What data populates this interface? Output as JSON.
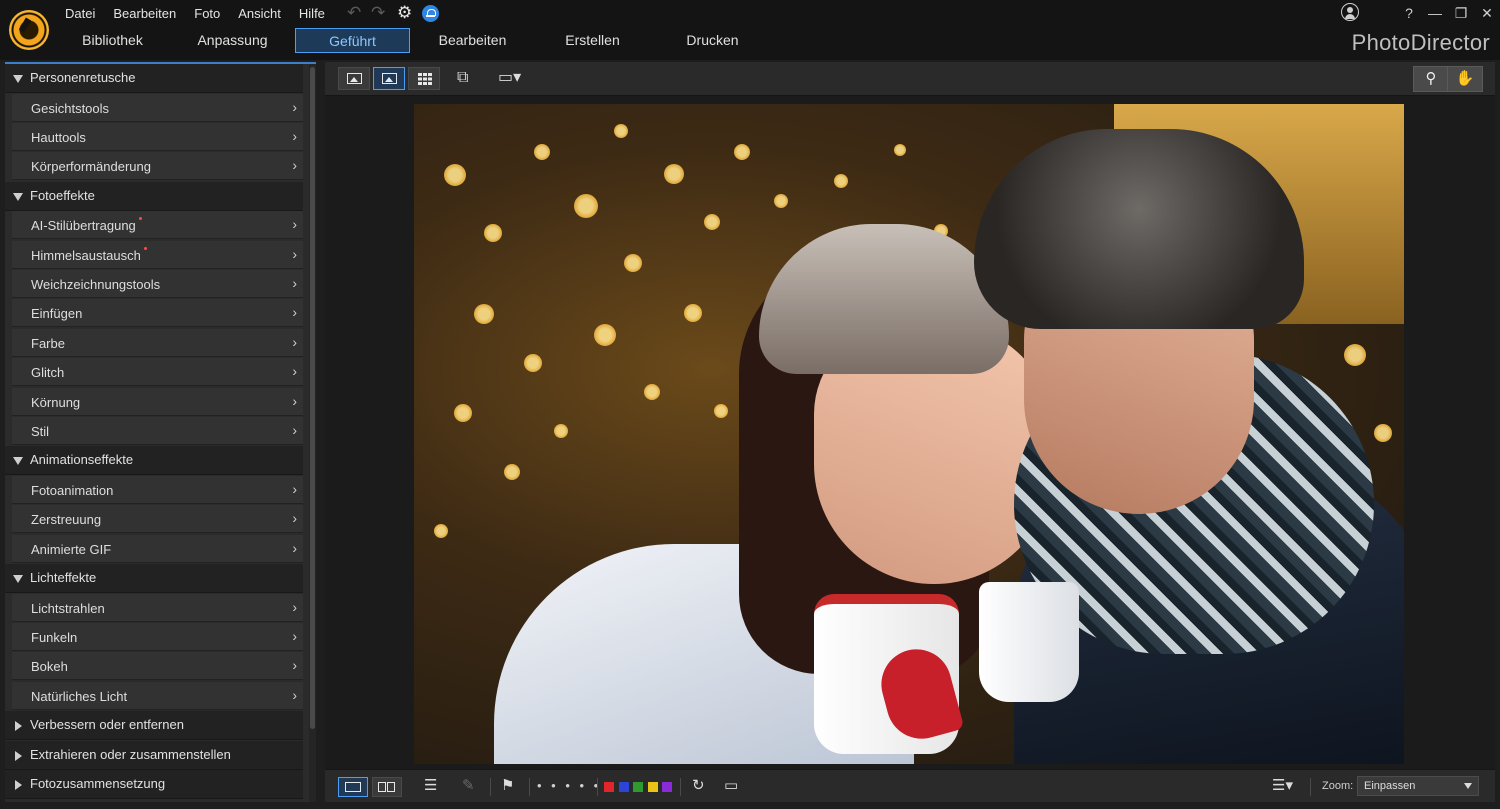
{
  "menu": [
    "Datei",
    "Bearbeiten",
    "Foto",
    "Ansicht",
    "Hilfe"
  ],
  "icons": {
    "undo": "↶",
    "redo": "↷",
    "settings": "⚙",
    "help": "?",
    "minimize": "—",
    "restore": "❐",
    "close": "✕",
    "chevron": "›",
    "search": "🔍",
    "hand": "✋",
    "sort": "☰",
    "rotate": "↻",
    "pen": "✎",
    "flag": "⚑",
    "compare": "⧉"
  },
  "nav_tabs": [
    "Bibliothek",
    "Anpassung",
    "Geführt",
    "Bearbeiten",
    "Erstellen",
    "Drucken"
  ],
  "active_tab": "Geführt",
  "brand": "PhotoDirector",
  "sections": [
    {
      "label": "Personenretusche",
      "open": true,
      "items": [
        {
          "label": "Gesichtstools"
        },
        {
          "label": "Hauttools"
        },
        {
          "label": "Körperformänderung"
        }
      ]
    },
    {
      "label": "Fotoeffekte",
      "open": true,
      "items": [
        {
          "label": "AI-Stilübertragung",
          "new": true
        },
        {
          "label": "Himmelsaustausch",
          "new": true
        },
        {
          "label": "Weichzeichnungstools"
        },
        {
          "label": "Einfügen"
        },
        {
          "label": "Farbe"
        },
        {
          "label": "Glitch"
        },
        {
          "label": "Körnung"
        },
        {
          "label": "Stil"
        }
      ]
    },
    {
      "label": "Animationseffekte",
      "open": true,
      "items": [
        {
          "label": "Fotoanimation"
        },
        {
          "label": "Zerstreuung"
        },
        {
          "label": "Animierte GIF"
        }
      ]
    },
    {
      "label": "Lichteffekte",
      "open": true,
      "items": [
        {
          "label": "Lichtstrahlen"
        },
        {
          "label": "Funkeln"
        },
        {
          "label": "Bokeh"
        },
        {
          "label": "Natürliches Licht"
        }
      ]
    },
    {
      "label": "Verbessern oder entfernen",
      "open": false,
      "items": []
    },
    {
      "label": "Extrahieren oder zusammenstellen",
      "open": false,
      "items": []
    },
    {
      "label": "Fotozusammensetzung",
      "open": false,
      "items": []
    }
  ],
  "bottom": {
    "rating_dots": "• • • • •",
    "color_tags": [
      "#e0262b",
      "#2c45d8",
      "#2f9a2f",
      "#e9c316",
      "#8a2ad8"
    ],
    "zoom_label": "Zoom:",
    "zoom_value": "Einpassen"
  }
}
